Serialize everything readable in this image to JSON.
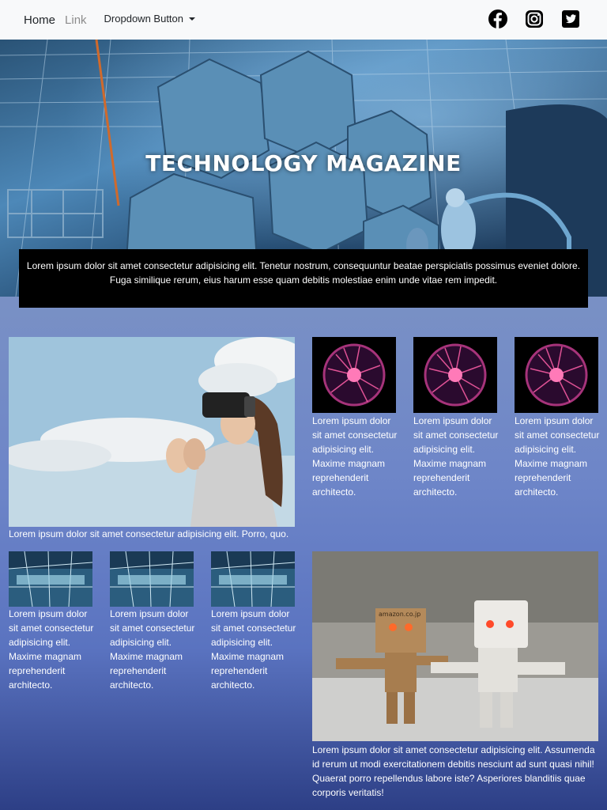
{
  "navbar": {
    "home": "Home",
    "link": "Link",
    "dropdown": "Dropdown Button",
    "social": [
      "facebook-icon",
      "instagram-icon",
      "twitter-icon"
    ]
  },
  "hero": {
    "title": "TECHNOLOGY MAGAZINE",
    "blurb": "Lorem ipsum dolor sit amet consectetur adipisicing elit. Tenetur nostrum, consequuntur beatae perspiciatis possimus eveniet dolore. Fuga similique rerum, eius harum esse quam debitis molestiae enim unde vitae rem impedit."
  },
  "feature_left": {
    "caption": "Lorem ipsum dolor sit amet consectetur adipisicing elit. Porro, quo."
  },
  "cards_top": [
    {
      "text": "Lorem ipsum dolor sit amet consectetur adipisicing elit. Maxime magnam reprehenderit architecto."
    },
    {
      "text": "Lorem ipsum dolor sit amet consectetur adipisicing elit. Maxime magnam reprehenderit architecto."
    },
    {
      "text": "Lorem ipsum dolor sit amet consectetur adipisicing elit. Maxime magnam reprehenderit architecto."
    }
  ],
  "cards_bottom": [
    {
      "text": "Lorem ipsum dolor sit amet consectetur adipisicing elit. Maxime magnam reprehenderit architecto."
    },
    {
      "text": "Lorem ipsum dolor sit amet consectetur adipisicing elit. Maxime magnam reprehenderit architecto."
    },
    {
      "text": "Lorem ipsum dolor sit amet consectetur adipisicing elit. Maxime magnam reprehenderit architecto."
    }
  ],
  "feature_right": {
    "box_label": "amazon.co.jp",
    "caption": "Lorem ipsum dolor sit amet consectetur adipisicing elit. Assumenda id rerum ut modi exercitationem debitis nesciunt ad sunt quasi nihil! Quaerat porro repellendus labore iste? Asperiores blanditiis quae corporis veritatis!"
  }
}
